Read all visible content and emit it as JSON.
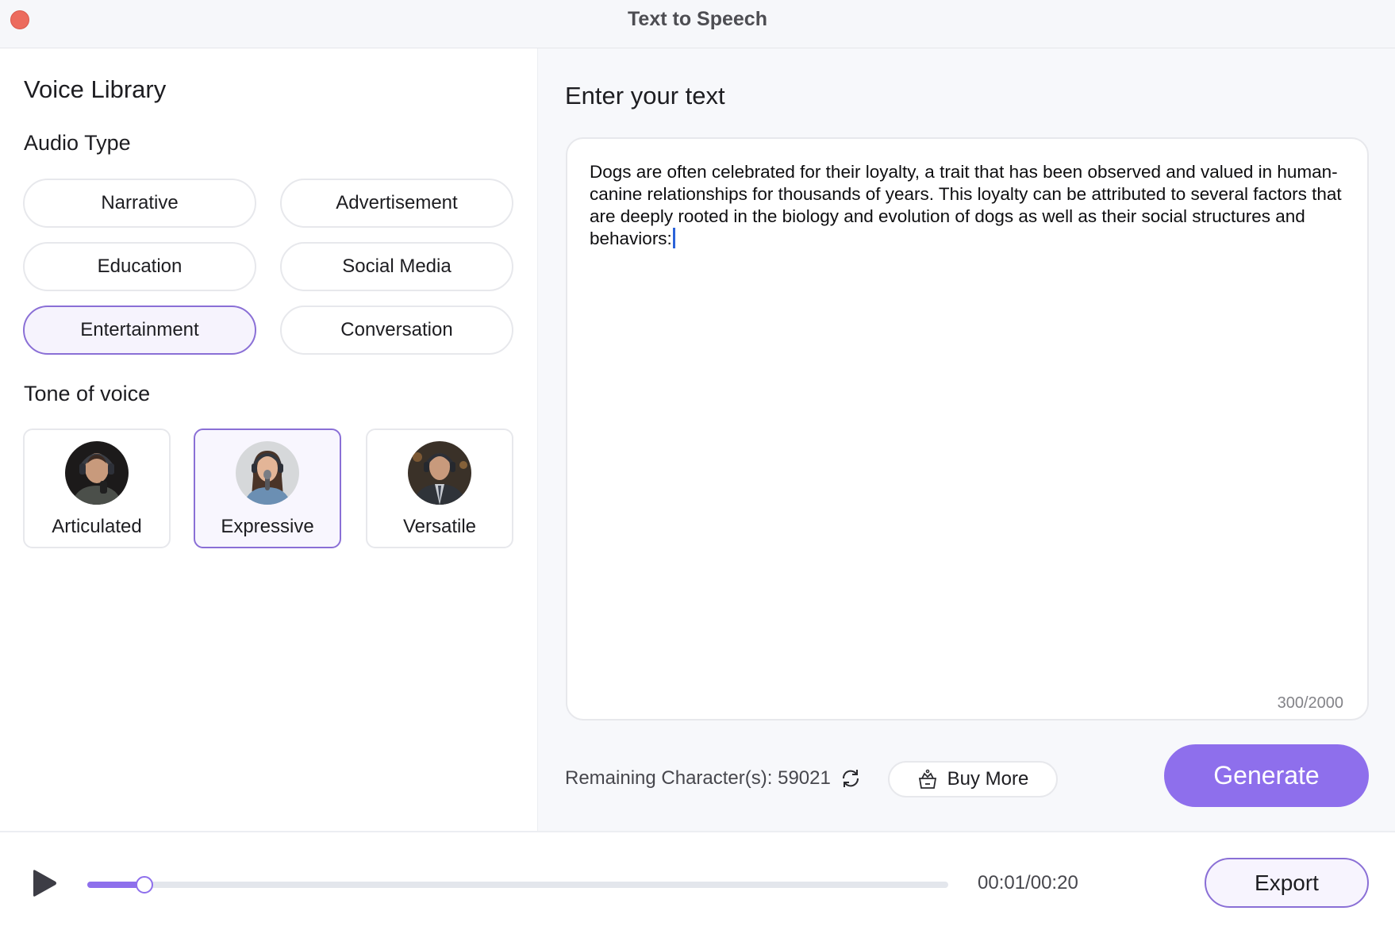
{
  "window": {
    "title": "Text to Speech",
    "close_icon": "close-dot-icon"
  },
  "left": {
    "heading": "Voice Library",
    "audio_type": {
      "heading": "Audio Type",
      "options": [
        {
          "label": "Narrative",
          "selected": false
        },
        {
          "label": "Advertisement",
          "selected": false
        },
        {
          "label": "Education",
          "selected": false
        },
        {
          "label": "Social Media",
          "selected": false
        },
        {
          "label": "Entertainment",
          "selected": true
        },
        {
          "label": "Conversation",
          "selected": false
        }
      ]
    },
    "tone": {
      "heading": "Tone of voice",
      "options": [
        {
          "label": "Articulated",
          "selected": false,
          "avatar": "man-with-headphones-avatar"
        },
        {
          "label": "Expressive",
          "selected": true,
          "avatar": "woman-with-microphone-avatar"
        },
        {
          "label": "Versatile",
          "selected": false,
          "avatar": "man-in-suit-avatar"
        }
      ]
    }
  },
  "right": {
    "heading": "Enter your text",
    "text": "Dogs are often celebrated for their loyalty, a trait that has been observed and valued in human-canine relationships for thousands of years. This loyalty can be attributed to several factors that are deeply rooted in the biology and evolution of dogs as well as their social structures and behaviors:",
    "char_count": "300/2000",
    "remaining_label": "Remaining Character(s): 59021",
    "refresh_icon": "refresh-icon",
    "buy_more_label": "Buy More",
    "buy_more_icon": "crown-basket-icon",
    "generate_label": "Generate"
  },
  "player": {
    "play_icon": "play-icon",
    "progress": 0.066,
    "time": "00:01/00:20",
    "export_label": "Export"
  },
  "colors": {
    "accent": "#8e6fec",
    "selected_border": "#8a6fd6",
    "close": "#ec6b5e"
  }
}
